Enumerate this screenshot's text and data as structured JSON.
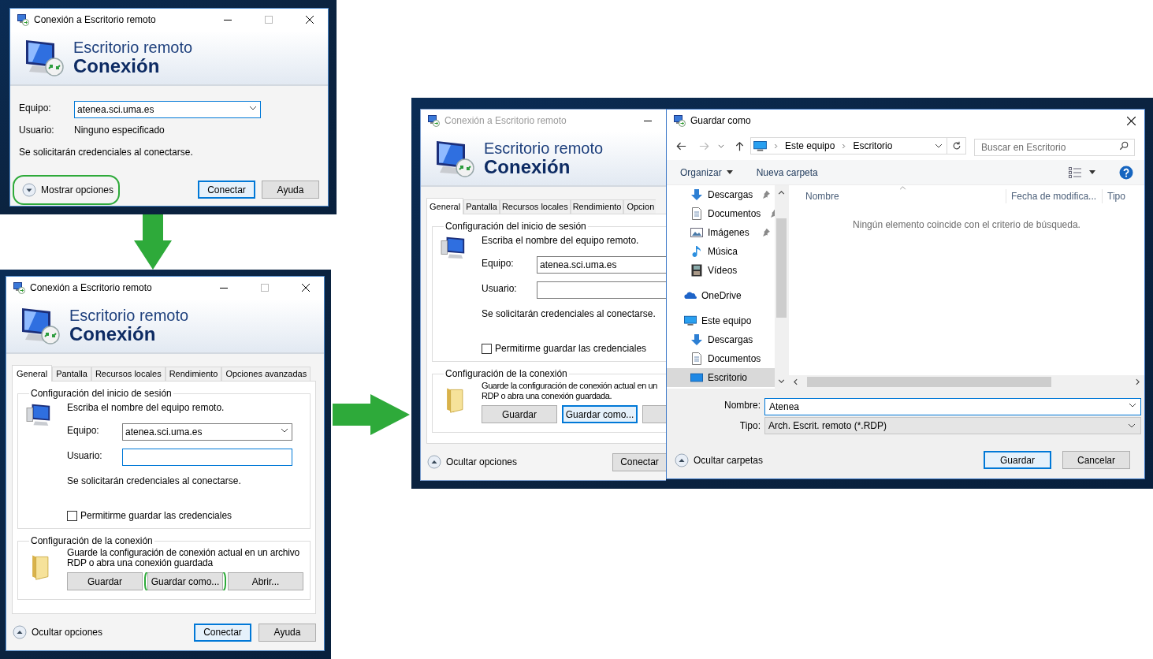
{
  "step_1": {
    "title": "Conexión a Escritorio remoto",
    "active": true,
    "banner": {
      "line_1": "Escritorio remoto",
      "line_2": "Conexión"
    },
    "computer": {
      "label": "Equipo:",
      "value": "atenea.sci.uma.es",
      "focused": true
    },
    "user": {
      "label": "Usuario:",
      "value": "Ninguno especificado"
    },
    "note": "Se solicitarán credenciales al conectarse.",
    "options_toggle": {
      "label": "Mostrar opciones",
      "expanded": false,
      "highlighted": true
    },
    "buttons": [
      {
        "label": "Conectar",
        "default": true
      },
      {
        "label": "Ayuda",
        "default": false
      }
    ]
  },
  "step_2": {
    "title": "Conexión a Escritorio remoto",
    "active": true,
    "banner": {
      "line_1": "Escritorio remoto",
      "line_2": "Conexión"
    },
    "tabs": [
      {
        "label": "General",
        "selected": true
      },
      {
        "label": "Pantalla",
        "selected": false
      },
      {
        "label": "Recursos locales",
        "selected": false
      },
      {
        "label": "Rendimiento",
        "selected": false
      },
      {
        "label": "Opciones avanzadas",
        "selected": false
      }
    ],
    "login_group": {
      "title": "Configuración del inicio de sesión",
      "hint": "Escriba el nombre del equipo remoto.",
      "computer": {
        "label": "Equipo:",
        "value": "atenea.sci.uma.es",
        "focused": false
      },
      "user": {
        "label": "Usuario:",
        "focused": true
      },
      "note": "Se solicitarán credenciales al conectarse.",
      "save_credentials": {
        "label": "Permitirme guardar las credenciales",
        "checked": false
      }
    },
    "connection_group": {
      "title": "Configuración de la conexión",
      "description": [
        "Guarde la configuración de conexión actual en un archivo",
        "RDP o abra una conexión guardada"
      ],
      "buttons": [
        {
          "label": "Guardar",
          "focused": false,
          "highlighted": false
        },
        {
          "label": "Guardar como...",
          "focused": false,
          "highlighted": true
        },
        {
          "label": "Abrir...",
          "focused": false,
          "highlighted": false
        }
      ]
    },
    "options_toggle": {
      "label": "Ocultar opciones",
      "expanded": true,
      "highlighted": false
    },
    "buttons": [
      {
        "label": "Conectar",
        "default": true
      },
      {
        "label": "Ayuda",
        "default": false
      }
    ]
  },
  "step_3": {
    "rdp_window": {
      "title": "Conexión a Escritorio remoto",
      "active": false,
      "banner": {
        "line_1": "Escritorio remoto",
        "line_2": "Conexión"
      },
      "tabs": [
        {
          "label": "General",
          "selected": true
        },
        {
          "label": "Pantalla",
          "selected": false
        },
        {
          "label": "Recursos locales",
          "selected": false
        },
        {
          "label": "Rendimiento",
          "selected": false
        },
        {
          "label": "Opcion",
          "selected": false
        }
      ],
      "login_group": {
        "title": "Configuración del inicio de sesión",
        "hint": "Escriba el nombre del equipo remoto.",
        "computer": {
          "label": "Equipo:",
          "value": "atenea.sci.uma.es",
          "focused": false
        },
        "user": {
          "label": "Usuario:",
          "focused": false
        },
        "note": "Se solicitarán credenciales al conectarse.",
        "save_credentials": {
          "label": "Permitirme guardar las credenciales",
          "checked": false
        }
      },
      "connection_group": {
        "title": "Configuración de la conexión",
        "description": [
          "Guarde la configuración de conexión actual en un",
          "RDP o abra una conexión guardada."
        ],
        "buttons": [
          {
            "label": "Guardar",
            "focused": false
          },
          {
            "label": "Guardar como...",
            "focused": true
          }
        ]
      },
      "options_toggle": {
        "label": "Ocultar opciones",
        "expanded": true
      },
      "buttons": [
        {
          "label": "Conectar",
          "default": false
        }
      ]
    },
    "save_dialog": {
      "title": "Guardar como",
      "address": [
        "Este equipo",
        "Escritorio"
      ],
      "search": {
        "placeholder": "Buscar en Escritorio"
      },
      "commands": {
        "organize": "Organizar",
        "new_folder": "Nueva carpeta"
      },
      "quick_access": [
        {
          "label": "Descargas",
          "kind": "download",
          "pinned": true,
          "selected": false
        },
        {
          "label": "Documentos",
          "kind": "document",
          "pinned": true,
          "selected": false
        },
        {
          "label": "Imágenes",
          "kind": "pictures",
          "pinned": true,
          "selected": false
        },
        {
          "label": "Música",
          "kind": "music",
          "pinned": false,
          "selected": false
        },
        {
          "label": "Vídeos",
          "kind": "video",
          "pinned": false,
          "selected": false
        }
      ],
      "nav_tree": [
        {
          "label": "OneDrive",
          "kind": "cloud",
          "selected": false
        },
        {
          "label": "Este equipo",
          "kind": "computer",
          "selected": false,
          "children": [
            {
              "label": "Descargas",
              "kind": "download",
              "selected": false
            },
            {
              "label": "Documentos",
              "kind": "document",
              "selected": false
            },
            {
              "label": "Escritorio",
              "kind": "desktop",
              "selected": true
            }
          ]
        }
      ],
      "columns": [
        "Nombre",
        "Fecha de modifica...",
        "Tipo"
      ],
      "empty_message": "Ningún elemento coincide con el criterio de búsqueda.",
      "file_name": {
        "label": "Nombre:",
        "value": "Atenea"
      },
      "file_type": {
        "label": "Tipo:",
        "value": "Arch. Escrit. remoto (*.RDP)"
      },
      "folders_toggle": {
        "label": "Ocultar carpetas",
        "expanded": true
      },
      "buttons": [
        {
          "label": "Guardar",
          "default": true
        },
        {
          "label": "Cancelar",
          "default": false
        }
      ]
    }
  }
}
